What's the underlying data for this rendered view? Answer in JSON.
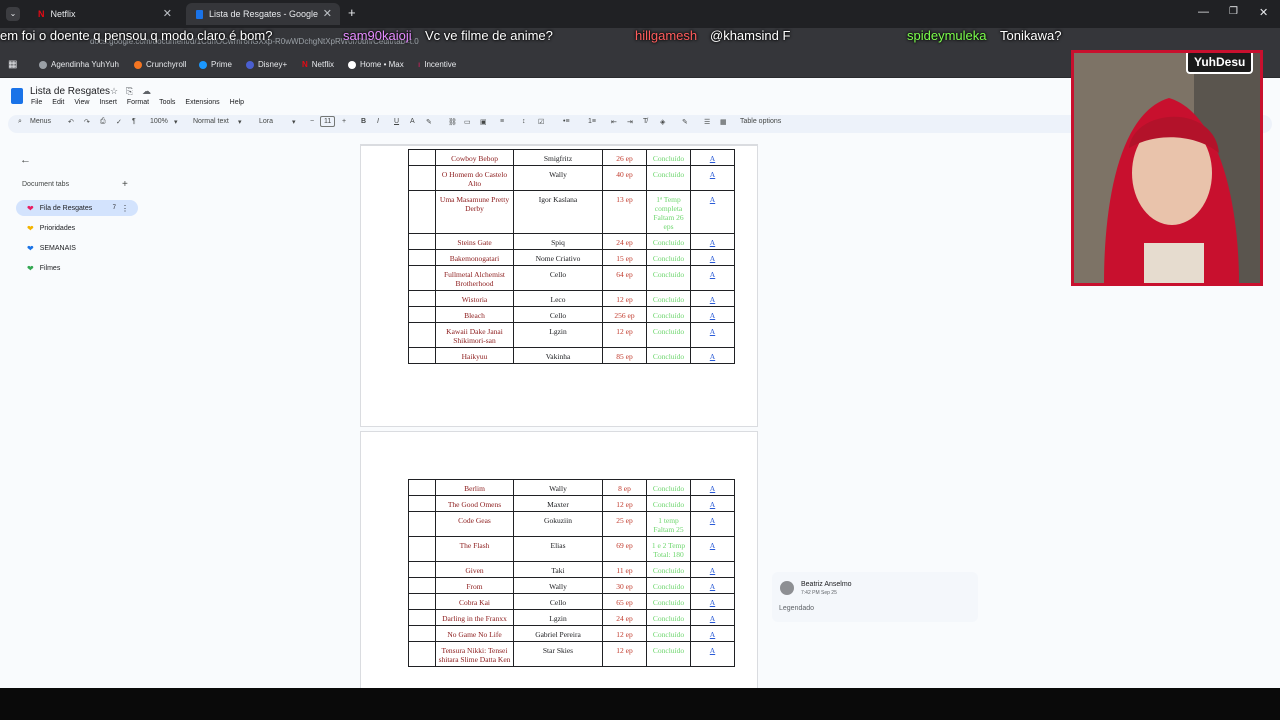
{
  "browser": {
    "tabs": [
      {
        "label": "Netflix",
        "active": false
      },
      {
        "label": "Lista de Resgates - Google Doc",
        "active": true
      }
    ],
    "url": "docs.google.com/document/d/1CuhOCwrnr6nGXxp-R0wWDchgNtXpRW0r/0bn/Cedit/tab=t.0",
    "bookmarks": [
      "Agendinha YuhYuh",
      "Crunchyroll",
      "Prime",
      "Disney+",
      "Netflix",
      "Home • Max",
      "Incentive"
    ]
  },
  "chat": [
    {
      "user": "",
      "msg": "em foi o doente q pensou q modo claro é bom?"
    },
    {
      "user": "sam90kaioji",
      "msg": "Vc ve filme de anime?"
    },
    {
      "user": "hillgamesh",
      "msg": "@khamsind F"
    },
    {
      "user": "spideymuleka",
      "msg": "Tonikawa?"
    }
  ],
  "doc": {
    "title": "Lista de Resgates",
    "menu": [
      "File",
      "Edit",
      "View",
      "Insert",
      "Format",
      "Tools",
      "Extensions",
      "Help"
    ],
    "toolbar": {
      "menus": "Menus",
      "zoom": "100%",
      "style": "Normal text",
      "font": "Lora",
      "size": "11",
      "table_options": "Table options"
    }
  },
  "sidebar": {
    "heading": "Document tabs",
    "items": [
      {
        "label": "Fila de Resgates",
        "heart": "#e91e63",
        "badge": "7",
        "active": true
      },
      {
        "label": "Prioridades",
        "heart": "#f4b400"
      },
      {
        "label": "SEMANAIS",
        "heart": "#1a73e8"
      },
      {
        "label": "Filmes",
        "heart": "#34a853"
      }
    ]
  },
  "table1": [
    [
      "Cowboy Bebop",
      "Smigfritz",
      "26 ep",
      "Concluído"
    ],
    [
      "O Homem do Castelo Alto",
      "Wally",
      "40 ep",
      "Concluído"
    ],
    [
      "Uma Masamune Pretty Derby",
      "Igor Kaslana",
      "13 ep",
      "1ª Temp completa Faltam 26 eps"
    ],
    [
      "Steins Gate",
      "Spiq",
      "24 ep",
      "Concluído"
    ],
    [
      "Bakemonogatari",
      "Nome Criativo",
      "15 ep",
      "Concluído"
    ],
    [
      "Fullmetal Alchemist Brotherhood",
      "Cello",
      "64 ep",
      "Concluído"
    ],
    [
      "Wistoria",
      "Leco",
      "12 ep",
      "Concluído"
    ],
    [
      "Bleach",
      "Cello",
      "256 ep",
      "Concluído"
    ],
    [
      "Kawaii Dake Janai Shikimori-san",
      "Lgzin",
      "12 ep",
      "Concluído"
    ],
    [
      "Haikyuu",
      "Vakinha",
      "85 ep",
      "Concluído"
    ]
  ],
  "table2": [
    [
      "Berlim",
      "Wally",
      "8 ep",
      "Concluído"
    ],
    [
      "The Good Omens",
      "Maxter",
      "12 ep",
      "Concluído"
    ],
    [
      "Code Geas",
      "Gokuziin",
      "25 ep",
      "1 temp Faltam 25"
    ],
    [
      "The Flash",
      "Elias",
      "69 ep",
      "1 e 2 Temp Total: 180"
    ],
    [
      "Given",
      "Taki",
      "11 ep",
      "Concluído"
    ],
    [
      "From",
      "Wally",
      "30 ep",
      "Concluído"
    ],
    [
      "Cobra Kai",
      "Cello",
      "65 ep",
      "Concluído"
    ],
    [
      "Darling in the Franxx",
      "Lgzin",
      "24 ep",
      "Concluído"
    ],
    [
      "No Game No Life",
      "Gabriel Pereira",
      "12 ep",
      "Concluído"
    ],
    [
      "Tensura Nikki: Tensei shitara Slime Datta Ken",
      "Star Skies",
      "12 ep",
      "Concluído"
    ]
  ],
  "link_letter": "A",
  "comment": {
    "author": "Beatriz Anselmo",
    "time": "7:42 PM Sep 25",
    "text": "Legendado"
  },
  "webcam": {
    "name": "YuhDesu"
  },
  "colors": {
    "status_done": "#6dd66d",
    "title_red": "#8b1a1a",
    "ep_red": "#c0392b",
    "brand_docs": "#1a73e8"
  }
}
